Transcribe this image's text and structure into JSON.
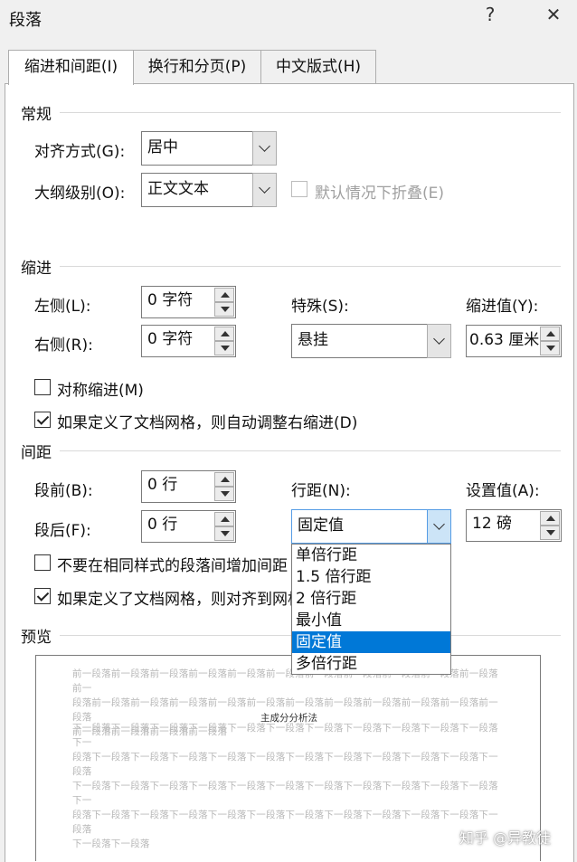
{
  "window": {
    "title": "段落",
    "help_btn": "?",
    "close_btn": "✕"
  },
  "tabs": [
    {
      "label": "缩进和间距(I)",
      "active": true
    },
    {
      "label": "换行和分页(P)",
      "active": false
    },
    {
      "label": "中文版式(H)",
      "active": false
    }
  ],
  "general": {
    "heading": "常规",
    "alignment_label": "对齐方式(G):",
    "alignment_value": "居中",
    "outline_label": "大纲级别(O):",
    "outline_value": "正文文本",
    "collapse_label": "默认情况下折叠(E)",
    "collapse_checked": false,
    "collapse_enabled": false
  },
  "indent": {
    "heading": "缩进",
    "left_label": "左侧(L):",
    "left_value": "0 字符",
    "right_label": "右侧(R):",
    "right_value": "0 字符",
    "special_label": "特殊(S):",
    "special_value": "悬挂",
    "by_label": "缩进值(Y):",
    "by_value": "0.63 厘米",
    "mirror_label": "对称缩进(M)",
    "mirror_checked": false,
    "auto_adjust_label": "如果定义了文档网格，则自动调整右缩进(D)",
    "auto_adjust_checked": true
  },
  "spacing": {
    "heading": "间距",
    "before_label": "段前(B):",
    "before_value": "0 行",
    "after_label": "段后(F):",
    "after_value": "0 行",
    "line_label": "行距(N):",
    "line_value": "固定值",
    "at_label": "设置值(A):",
    "at_value": "12 磅",
    "no_space_label": "不要在相同样式的段落间增加间距",
    "no_space_checked": false,
    "snap_grid_label": "如果定义了文档网格，则对齐到网格",
    "snap_grid_checked": true
  },
  "line_spacing_options": [
    "单倍行距",
    "1.5 倍行距",
    "2 倍行距",
    "最小值",
    "固定值",
    "多倍行距"
  ],
  "line_spacing_selected": "固定值",
  "preview": {
    "heading": "预览",
    "prev_lines": [
      "前一段落前一段落前一段落前一段落前一段落前一段落前一段落前一段落前一段落前一段落前一段落前一",
      "段落前一段落前一段落前一段落前一段落前一段落前一段落前一段落前一段落前一段落前一段落前一段落",
      "前一段落前一段落前一段落前一段落"
    ],
    "current_text": "主成分分析法",
    "next_lines": [
      "下一段落下一段落下一段落下一段落下一段落下一段落下一段落下一段落下一段落下一段落下一段落下一",
      "段落下一段落下一段落下一段落下一段落下一段落下一段落下一段落下一段落下一段落下一段落下一段落",
      "下一段落下一段落下一段落下一段落下一段落下一段落下一段落下一段落下一段落下一段落下一段落下一",
      "段落下一段落下一段落下一段落下一段落下一段落下一段落下一段落下一段落下一段落下一段落下一段落",
      "下一段落下一段落"
    ]
  },
  "watermark": "知乎 @异教徒",
  "colors": {
    "selection": "#0078d7",
    "dialog_bg": "#f0f0f0",
    "panel_bg": "#ffffff"
  }
}
